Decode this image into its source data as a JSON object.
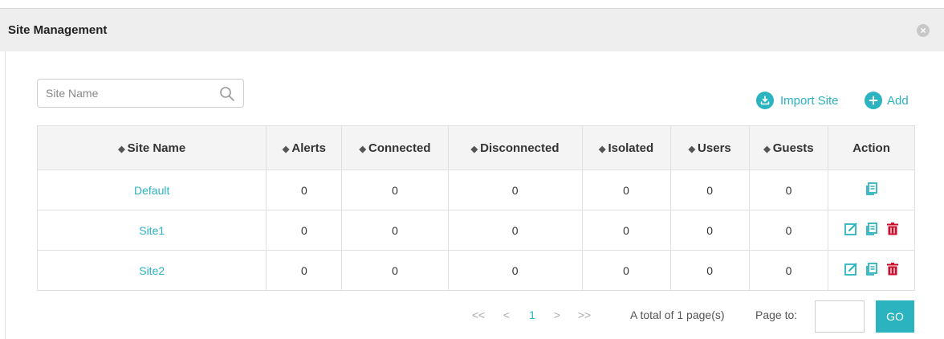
{
  "header": {
    "title": "Site Management",
    "close_icon": "close-icon"
  },
  "search": {
    "placeholder": "Site Name",
    "value": ""
  },
  "toolbar": {
    "import_label": "Import Site",
    "add_label": "Add"
  },
  "colors": {
    "accent": "#2bb3c0",
    "delete": "#c8102e",
    "header_bg": "#eeeeee"
  },
  "table": {
    "columns": [
      "Site Name",
      "Alerts",
      "Connected",
      "Disconnected",
      "Isolated",
      "Users",
      "Guests",
      "Action"
    ],
    "rows": [
      {
        "site": "Default",
        "alerts": "0",
        "connected": "0",
        "disconnected": "0",
        "isolated": "0",
        "users": "0",
        "guests": "0",
        "actions": [
          "copy"
        ]
      },
      {
        "site": "Site1",
        "alerts": "0",
        "connected": "0",
        "disconnected": "0",
        "isolated": "0",
        "users": "0",
        "guests": "0",
        "actions": [
          "edit",
          "copy",
          "delete"
        ]
      },
      {
        "site": "Site2",
        "alerts": "0",
        "connected": "0",
        "disconnected": "0",
        "isolated": "0",
        "users": "0",
        "guests": "0",
        "actions": [
          "edit",
          "copy",
          "delete"
        ]
      }
    ]
  },
  "pagination": {
    "first": "<<",
    "prev": "<",
    "current": "1",
    "next": ">",
    "last": ">>",
    "total_text": "A total of 1 page(s)",
    "page_to_label": "Page to:",
    "page_to_value": "",
    "go_label": "GO"
  }
}
